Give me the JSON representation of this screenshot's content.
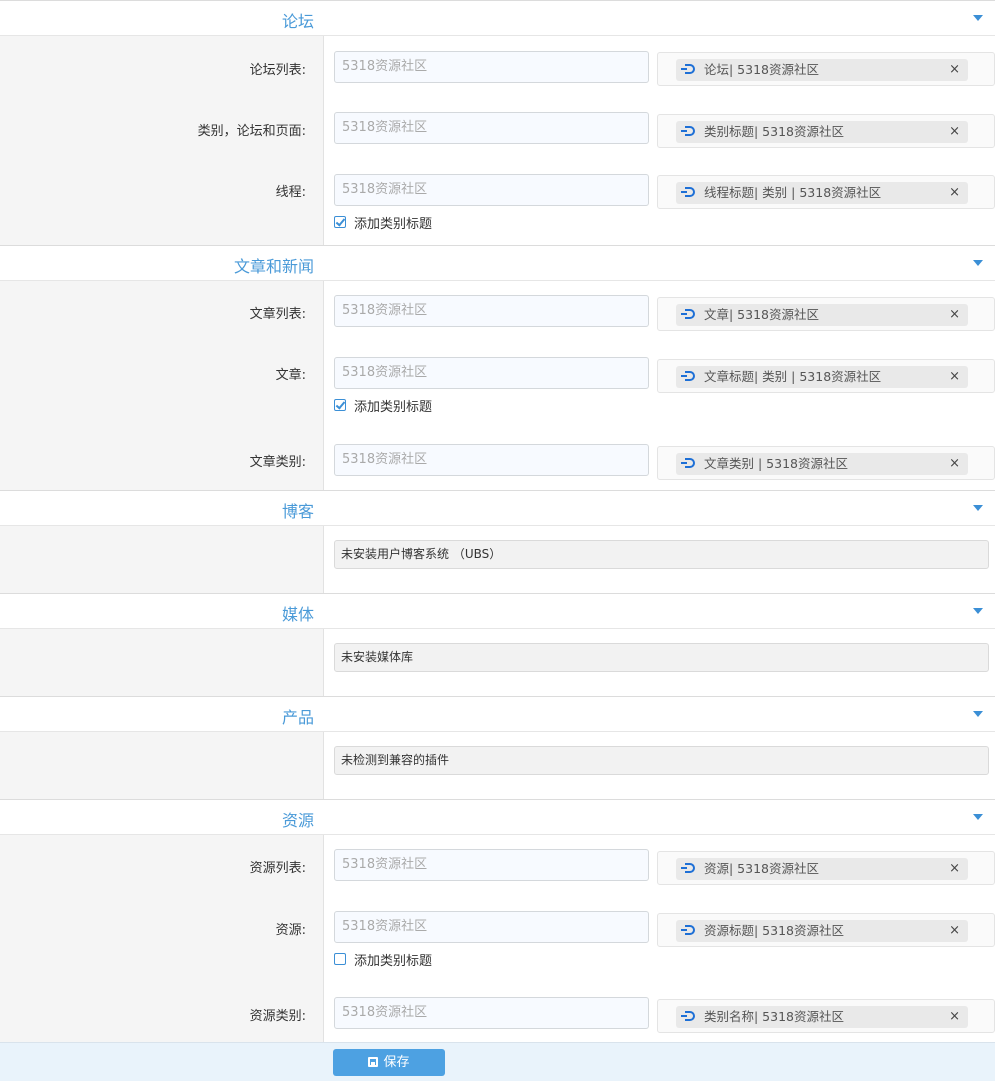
{
  "placeholder": "5318资源社区",
  "sections": {
    "forum": {
      "title": "论坛",
      "rows": [
        {
          "label": "论坛列表:",
          "token": "论坛|  5318资源社区"
        },
        {
          "label": "类别，论坛和页面:",
          "token": "类别标题|  5318资源社区"
        },
        {
          "label": "线程:",
          "token": "线程标题| 类别 | 5318资源社区"
        }
      ],
      "checkbox_label": "添加类别标题",
      "checkbox_checked": true
    },
    "articles": {
      "title": "文章和新闻",
      "rows": [
        {
          "label": "文章列表:",
          "token": "文章|  5318资源社区"
        },
        {
          "label": "文章:",
          "token": "文章标题| 类别 | 5318资源社区"
        },
        {
          "label": "文章类别:",
          "token": "文章类别 |  5318资源社区"
        }
      ],
      "checkbox_label": "添加类别标题",
      "checkbox_checked": true
    },
    "blog": {
      "title": "博客",
      "notice": "未安装用户博客系统 （UBS）"
    },
    "media": {
      "title": "媒体",
      "notice": "未安装媒体库"
    },
    "products": {
      "title": "产品",
      "notice": "未检测到兼容的插件"
    },
    "resources": {
      "title": "资源",
      "rows": [
        {
          "label": "资源列表:",
          "token": "资源|  5318资源社区"
        },
        {
          "label": "资源:",
          "token": "资源标题|  5318资源社区"
        },
        {
          "label": "资源类别:",
          "token": "类别名称|  5318资源社区"
        }
      ],
      "checkbox_label": "添加类别标题",
      "checkbox_checked": false
    }
  },
  "token_remove": "×",
  "save_label": "保存"
}
